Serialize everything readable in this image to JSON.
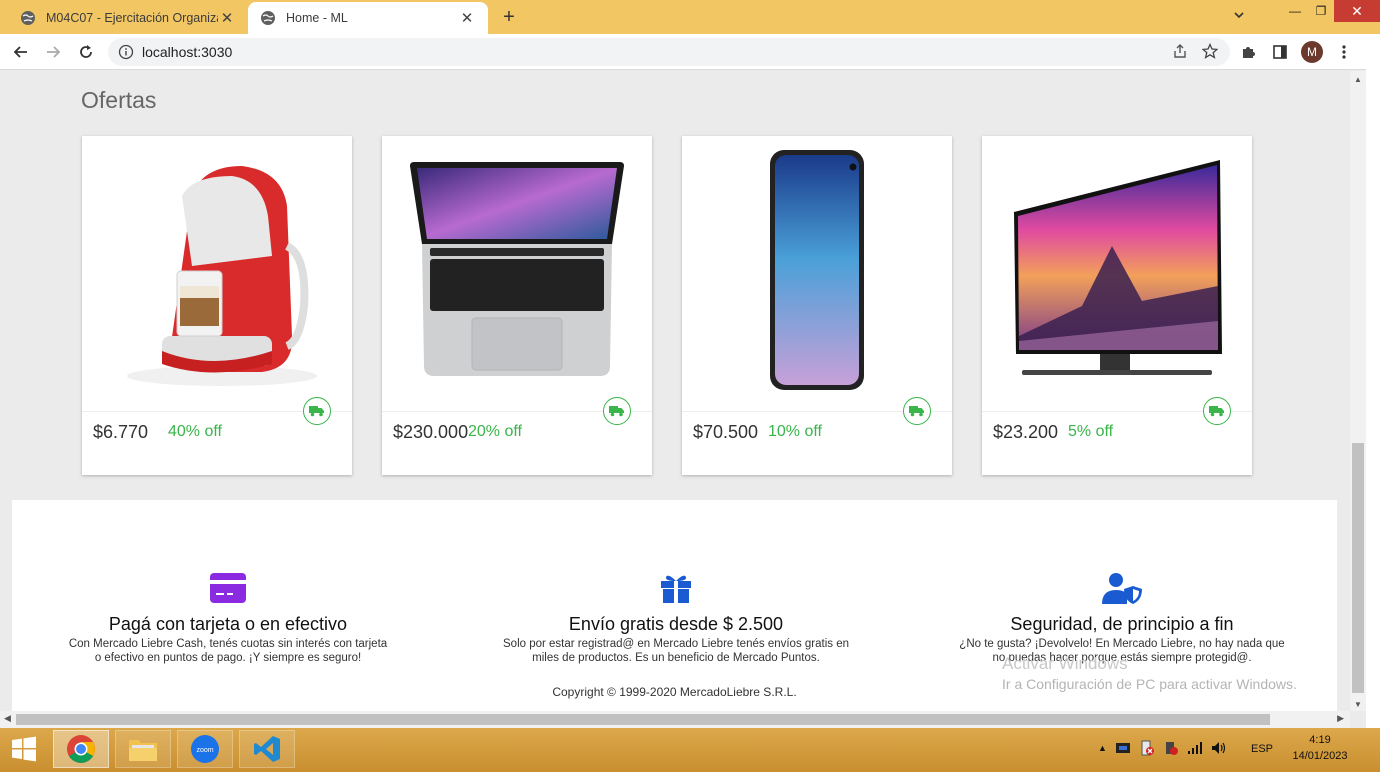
{
  "browser": {
    "tabs": [
      {
        "title": "M04C07 - Ejercitación Organizan",
        "active": false
      },
      {
        "title": "Home - ML",
        "active": true
      }
    ],
    "new_tab_symbol": "+",
    "url": "localhost:3030",
    "profile_initial": "M"
  },
  "page": {
    "section_title": "Ofertas",
    "products": [
      {
        "image": "coffee-machine",
        "price": "$6.770",
        "discount": "40% off"
      },
      {
        "image": "laptop",
        "price": "$230.000",
        "discount": "20% off"
      },
      {
        "image": "smartphone",
        "price": "$70.500",
        "discount": "10% off"
      },
      {
        "image": "television",
        "price": "$23.200",
        "discount": "5% off"
      }
    ],
    "features": [
      {
        "icon": "credit-card-icon",
        "title": "Pagá con tarjeta o en efectivo",
        "text_line1": "Con Mercado Liebre Cash, tenés cuotas sin interés con tarjeta",
        "text_line2": "o efectivo en puntos de pago. ¡Y siempre es seguro!"
      },
      {
        "icon": "gift-icon",
        "title": "Envío gratis desde $ 2.500",
        "text_line1": "Solo por estar registrad@ en Mercado Liebre tenés envíos gratis en",
        "text_line2": "miles de productos. Es un beneficio de Mercado Puntos."
      },
      {
        "icon": "user-shield-icon",
        "title": "Seguridad, de principio a fin",
        "text_line1": "¿No te gusta? ¡Devolvelo! En Mercado Liebre, no hay nada que",
        "text_line2": "no puedas hacer porque estás siempre protegid@."
      }
    ],
    "copyright": "Copyright © 1999-2020 MercadoLiebre S.R.L.",
    "watermark_line1": "Activar Windows",
    "watermark_line2": "Ir a Configuración de PC para activar Windows."
  },
  "colors": {
    "accent_green": "#39b54a",
    "card_icon_purple": "#8a2be2",
    "gift_blue": "#1a5bd1",
    "taskbar": "#d19a3a",
    "tabstrip": "#f2c663"
  },
  "taskbar": {
    "apps": [
      "chrome",
      "file-explorer",
      "zoom",
      "vscode"
    ],
    "language": "ESP",
    "time": "4:19",
    "date": "14/01/2023"
  }
}
